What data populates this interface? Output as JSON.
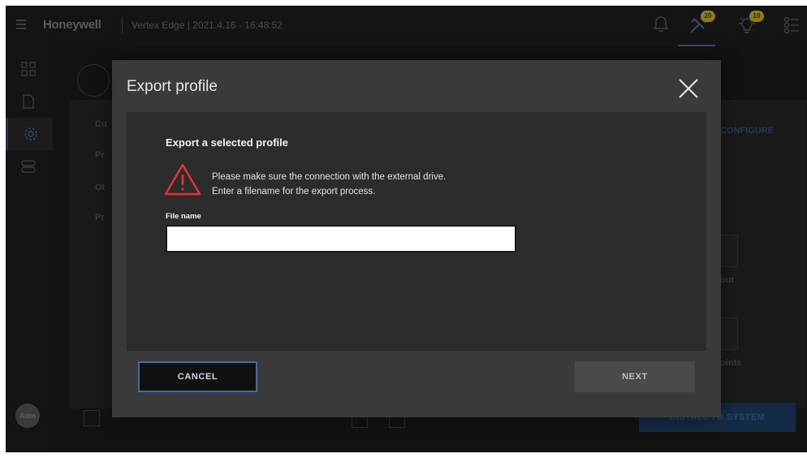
{
  "header": {
    "brand": "Honeywell",
    "title": "Vertex Edge | 2021.4.16 - 16:48:52",
    "badges": {
      "tools": "20",
      "alerts": "10"
    }
  },
  "sidebar": {
    "user": "Adm"
  },
  "background": {
    "col_headers": [
      "Cu",
      "Pr",
      "Ot",
      "Pr"
    ],
    "link": "CONFIGURE",
    "tile_labels": [
      "out",
      "oints"
    ],
    "install_button": "INSTALL TO SYSTEM"
  },
  "modal": {
    "title": "Export profile",
    "section_title": "Export a selected profile",
    "message_line1": "Please make sure the connection with the external drive.",
    "message_line2": "Enter a filename for the export process.",
    "field_label": "File name",
    "field_value": "",
    "cancel_label": "CANCEL",
    "next_label": "NEXT"
  },
  "colors": {
    "accent": "#3f6fa8",
    "warning": "#e3323b",
    "modal_bg": "#3a3a3a",
    "modal_body_bg": "#2c2c2c"
  }
}
